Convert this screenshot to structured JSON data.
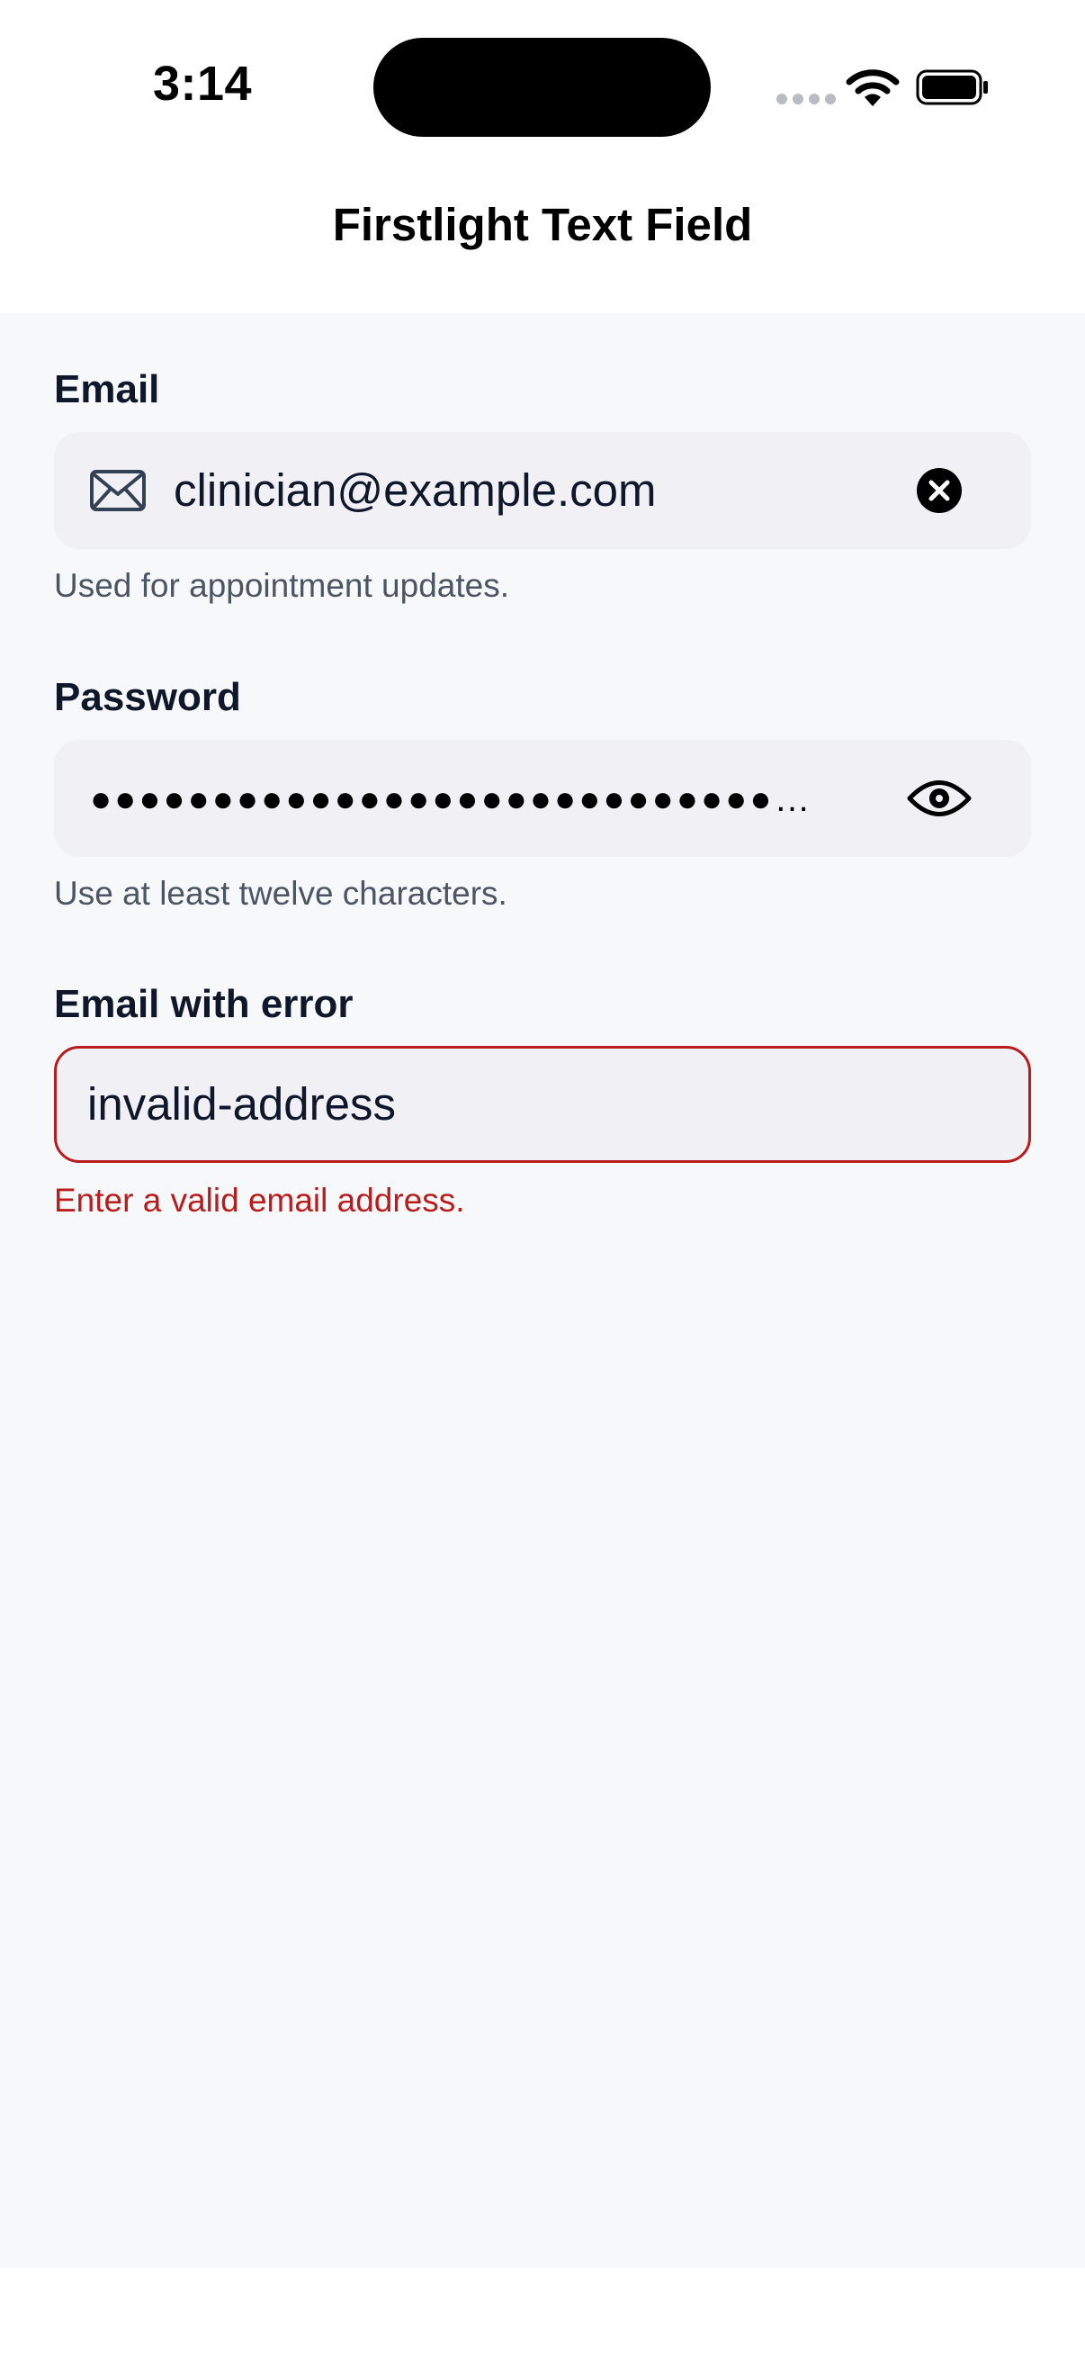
{
  "status_bar": {
    "time": "3:14"
  },
  "nav": {
    "title": "Firstlight Text Field"
  },
  "fields": {
    "email": {
      "label": "Email",
      "value": "clinician@example.com",
      "helper": "Used for appointment updates.",
      "leading_icon": "envelope-icon",
      "trailing_icon": "clear-icon"
    },
    "password": {
      "label": "Password",
      "masked_value": "●●●●●●●●●●●●●●●●●●●●●●●●●●●●…",
      "helper": "Use at least twelve characters.",
      "trailing_icon": "eye-icon"
    },
    "email_error": {
      "label": "Email with error",
      "value": "invalid-address",
      "error": "Enter a valid email address."
    }
  },
  "colors": {
    "error": "#b91c1c",
    "field_background": "#f1f1f5",
    "page_background": "#f7f8fa",
    "helper_text": "#4b5563"
  }
}
